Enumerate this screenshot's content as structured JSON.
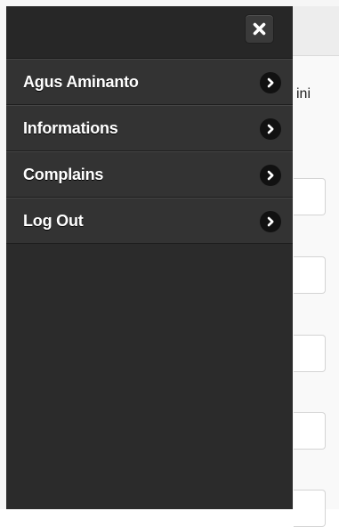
{
  "background": {
    "partial_text": "ini",
    "input_count": 5
  },
  "drawer": {
    "close_icon": "close-icon",
    "menu": [
      {
        "label": "Agus Aminanto",
        "icon": "chevron-right-icon"
      },
      {
        "label": "Informations",
        "icon": "chevron-right-icon"
      },
      {
        "label": "Complains",
        "icon": "chevron-right-icon"
      },
      {
        "label": "Log Out",
        "icon": "chevron-right-icon"
      }
    ]
  },
  "colors": {
    "drawer_bg": "#2b2b2b",
    "menu_item_bg": "#333333",
    "text": "#ffffff"
  }
}
